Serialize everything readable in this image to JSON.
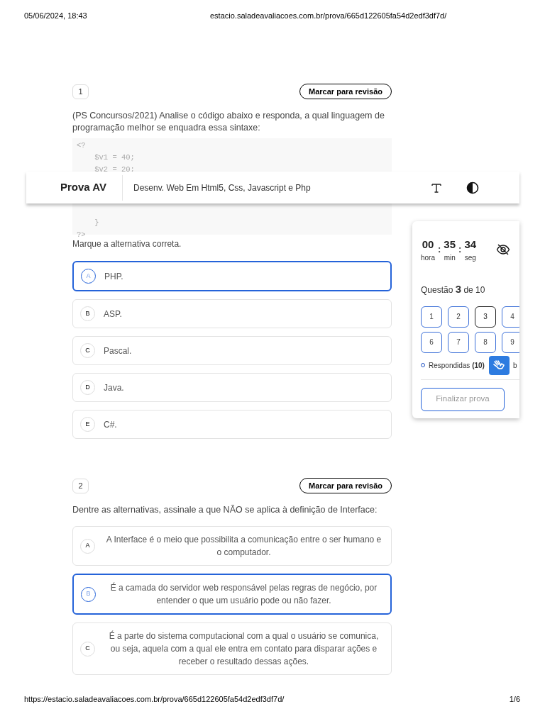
{
  "print_header": {
    "date": "05/06/2024, 18:43",
    "url": "estacio.saladeavaliacoes.com.br/prova/665d122605fa54d2edf3df7d/"
  },
  "app_bar": {
    "title": "Prova AV",
    "subject": "Desenv. Web Em Html5, Css, Javascript e Php"
  },
  "questions": [
    {
      "number": "1",
      "review_button": "Marcar para revisão",
      "statement": " (PS Concursos/2021) Analise o código abaixo e responda, a qual linguagem de programação melhor se enquadra essa sintaxe:",
      "code_above_bar": [
        "<?",
        "    $v1 = 40;",
        "    $v2 = 20;"
      ],
      "code_below_bar": [
        "    }",
        "?>"
      ],
      "prompt": "Marque a alternativa correta.",
      "options": [
        {
          "letter": "A",
          "text": "PHP.",
          "selected": true
        },
        {
          "letter": "B",
          "text": "ASP.",
          "selected": false
        },
        {
          "letter": "C",
          "text": "Pascal.",
          "selected": false
        },
        {
          "letter": "D",
          "text": "Java.",
          "selected": false
        },
        {
          "letter": "E",
          "text": "C#.",
          "selected": false
        }
      ]
    },
    {
      "number": "2",
      "review_button": "Marcar para revisão",
      "statement": "Dentre as alternativas, assinale a que NÃO se aplica à definição de Interface:",
      "options": [
        {
          "letter": "A",
          "text": "A Interface é o meio que possibilita a comunicação entre o ser humano e o computador.",
          "selected": false
        },
        {
          "letter": "B",
          "text": "É a camada do servidor web responsável pelas regras de negócio, por entender o que um usuário pode ou não fazer.",
          "selected": true
        },
        {
          "letter": "C",
          "text": "É a parte do sistema computacional com a qual o usuário se comunica, ou seja, aquela com a qual ele entra em contato para disparar ações e receber o resultado dessas ações.",
          "selected": false
        }
      ]
    }
  ],
  "timer_panel": {
    "hours": "00",
    "hours_label": "hora",
    "minutes": "35",
    "minutes_label": "min",
    "seconds": "34",
    "seconds_label": "seg",
    "separator": ":",
    "question_label": "Questão",
    "current": "3",
    "total_label": "de 10",
    "question_buttons": [
      {
        "label": "1",
        "selected": false
      },
      {
        "label": "2",
        "selected": false
      },
      {
        "label": "3",
        "selected": true
      },
      {
        "label": "4",
        "selected": false
      },
      {
        "label": "6",
        "selected": false
      },
      {
        "label": "7",
        "selected": false
      },
      {
        "label": "8",
        "selected": false
      },
      {
        "label": "9",
        "selected": false
      }
    ],
    "legend": "Respondidas **(10)**",
    "legend_cut": "b",
    "finish_button": "Finalizar prova"
  },
  "print_footer": {
    "url": "https://estacio.saladeavaliacoes.com.br/prova/665d122605fa54d2edf3df7d/",
    "page": "1/6"
  }
}
